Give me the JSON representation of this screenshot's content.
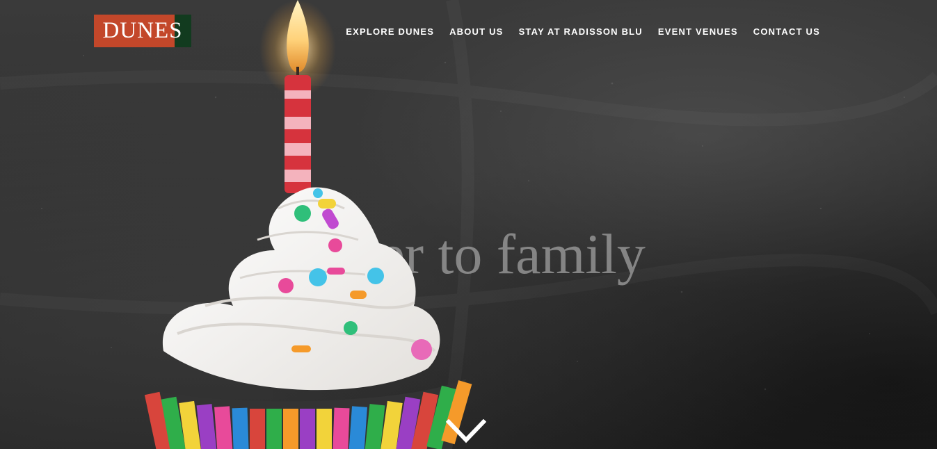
{
  "brand": {
    "logo_text": "DUNES",
    "primary_color": "#c3472a",
    "secondary_color": "#123b1f"
  },
  "nav": {
    "items": [
      {
        "label": "EXPLORE DUNES"
      },
      {
        "label": "ABOUT US"
      },
      {
        "label": "STAY AT RADISSON BLU"
      },
      {
        "label": "EVENT VENUES"
      },
      {
        "label": "CONTACT US"
      }
    ]
  },
  "hero": {
    "headline": "Closer to family",
    "scroll_icon": "chevron-down-icon"
  }
}
